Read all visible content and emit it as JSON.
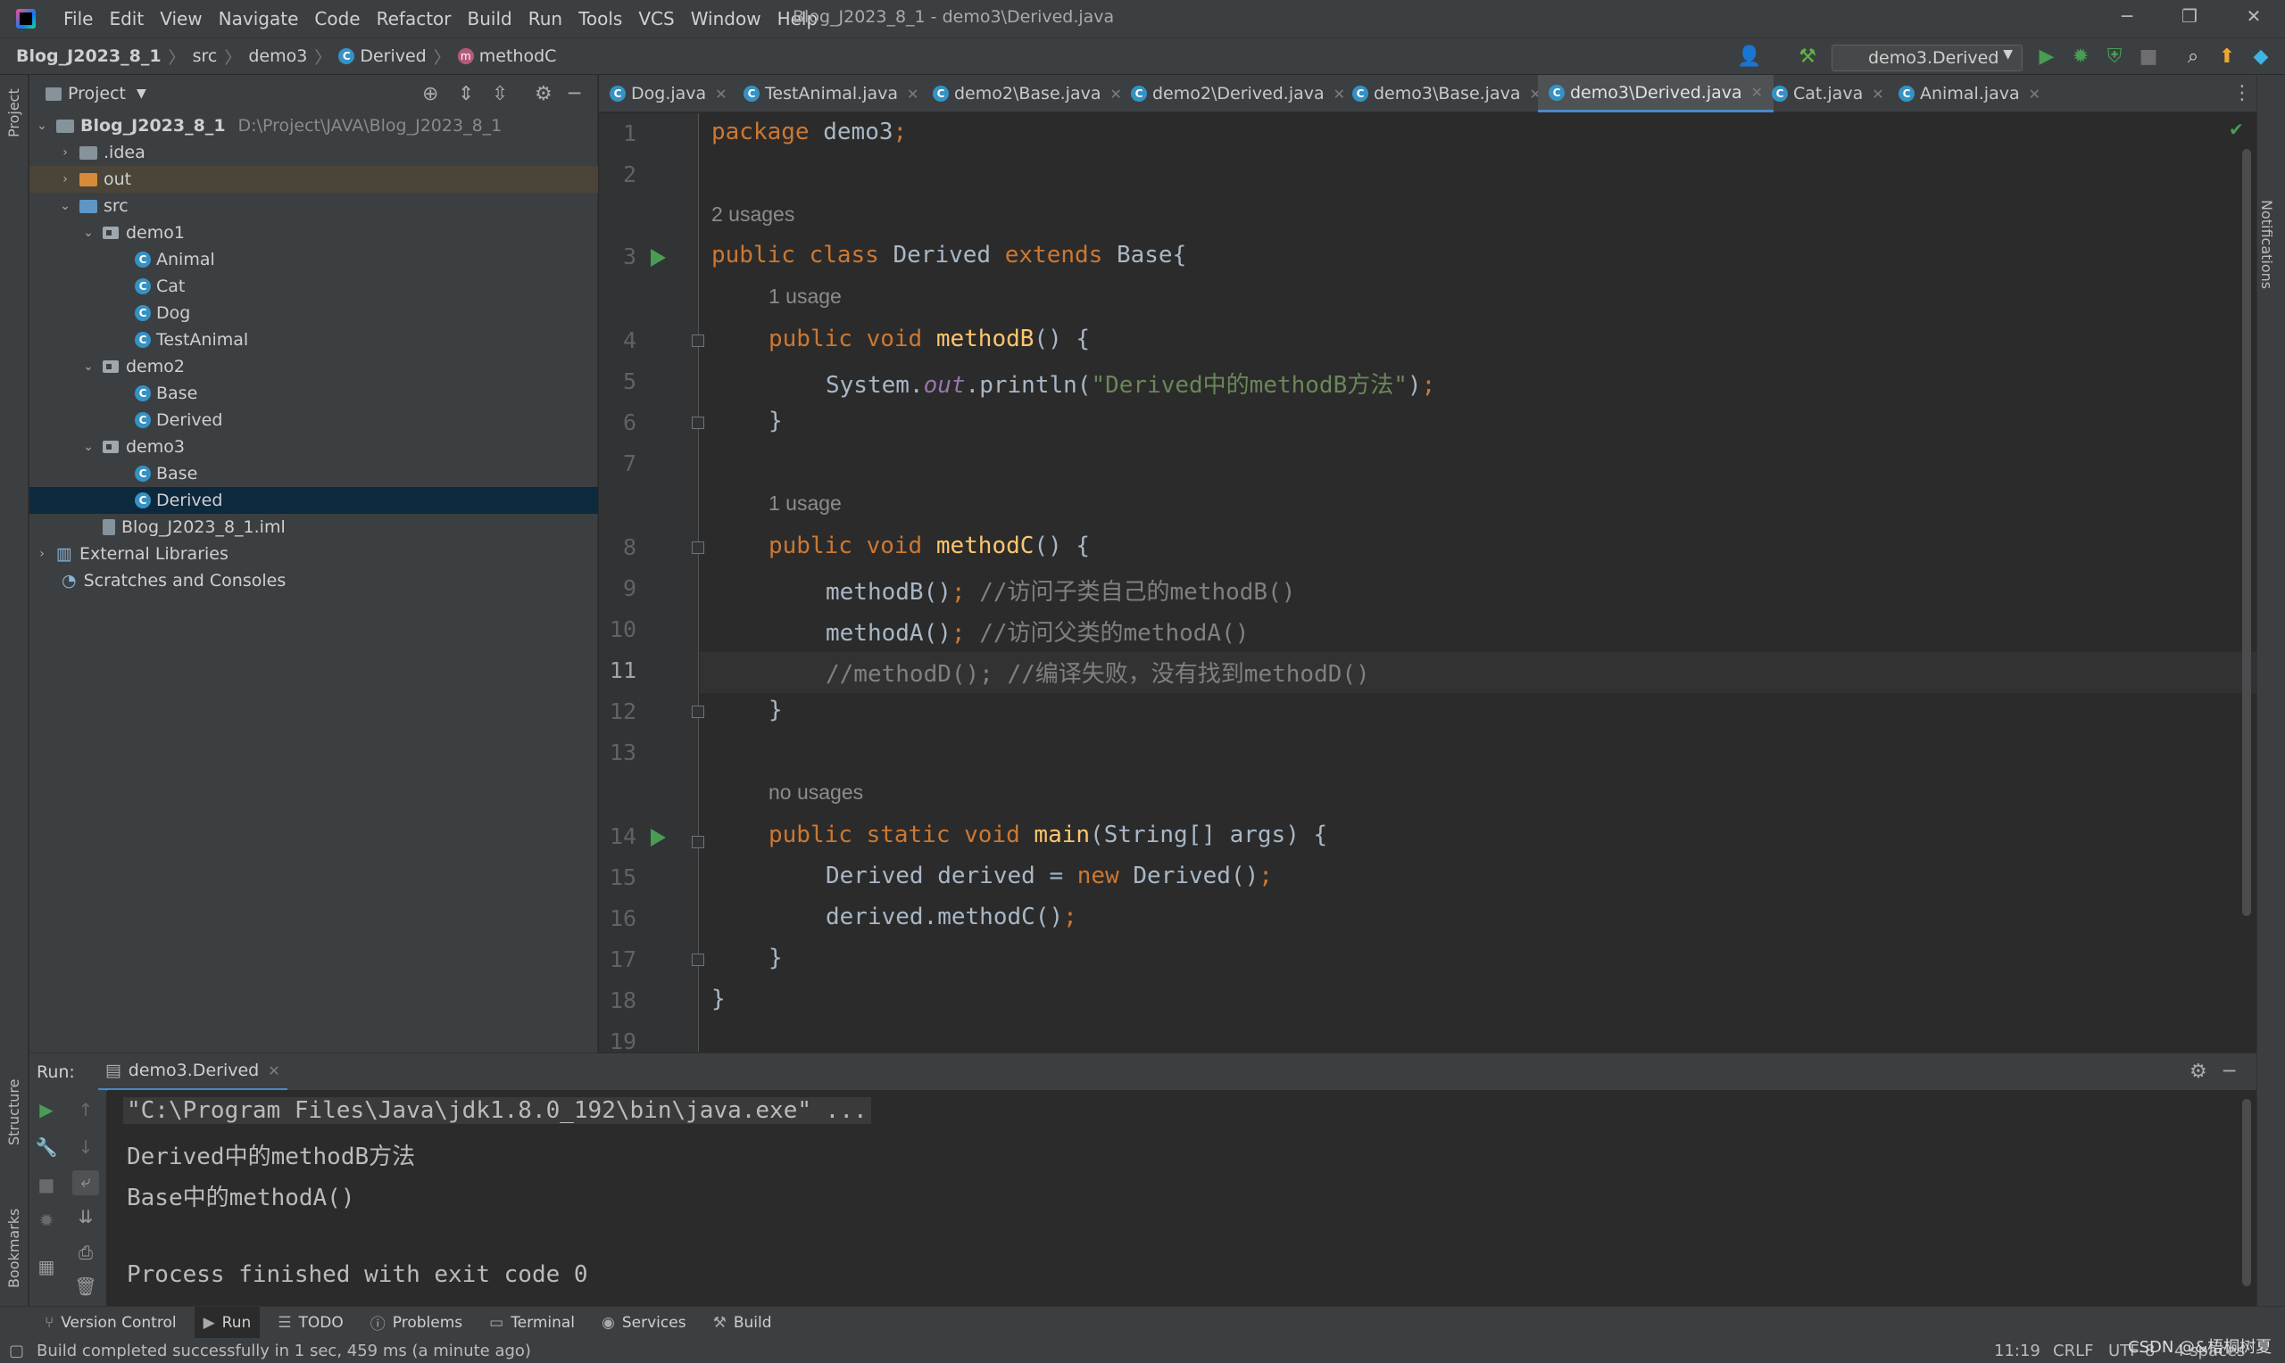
{
  "window": {
    "title": "Blog_J2023_8_1 - demo3\\Derived.java",
    "menu": [
      "File",
      "Edit",
      "View",
      "Navigate",
      "Code",
      "Refactor",
      "Build",
      "Run",
      "Tools",
      "VCS",
      "Window",
      "Help"
    ]
  },
  "navbar": {
    "breadcrumb": [
      "Blog_J2023_8_1",
      "src",
      "demo3",
      "Derived",
      "methodC"
    ],
    "run_config": "demo3.Derived"
  },
  "project": {
    "title": "Project",
    "tree": [
      {
        "label": "Blog_J2023_8_1",
        "path": "D:\\Project\\JAVA\\Blog_J2023_8_1"
      },
      {
        "label": ".idea"
      },
      {
        "label": "out"
      },
      {
        "label": "src"
      },
      {
        "label": "demo1"
      },
      {
        "label": "Animal"
      },
      {
        "label": "Cat"
      },
      {
        "label": "Dog"
      },
      {
        "label": "TestAnimal"
      },
      {
        "label": "demo2"
      },
      {
        "label": "Base"
      },
      {
        "label": "Derived"
      },
      {
        "label": "demo3"
      },
      {
        "label": "Base"
      },
      {
        "label": "Derived"
      },
      {
        "label": "Blog_J2023_8_1.iml"
      },
      {
        "label": "External Libraries"
      },
      {
        "label": "Scratches and Consoles"
      }
    ]
  },
  "tabs": [
    "Dog.java",
    "TestAnimal.java",
    "demo2\\Base.java",
    "demo2\\Derived.java",
    "demo3\\Base.java",
    "demo3\\Derived.java",
    "Cat.java",
    "Animal.java"
  ],
  "active_tab": "demo3\\Derived.java",
  "editor": {
    "line_numbers": [
      "1",
      "2",
      "3",
      "4",
      "5",
      "6",
      "7",
      "8",
      "9",
      "10",
      "11",
      "12",
      "13",
      "14",
      "15",
      "16",
      "17",
      "18",
      "19"
    ],
    "hints": [
      "2 usages",
      "1 usage",
      "1 usage",
      "no usages"
    ],
    "code": {
      "l1": {
        "kw": "package",
        "rest": " demo3",
        "semi": ";"
      },
      "l3": {
        "kw1": "public class",
        "name": " Derived ",
        "kw2": "extends",
        "rest": " Base{"
      },
      "l4": {
        "kw": "public void",
        "fn": "methodB",
        "rest": "() {"
      },
      "l5": {
        "a": "System.",
        "field": "out",
        "b": ".println(",
        "str": "\"Derived中的methodB方法\"",
        "c": ")",
        "semi": ";"
      },
      "l6": "}",
      "l8": {
        "kw": "public void",
        "fn": "methodC",
        "rest": "() {"
      },
      "l9": {
        "code": "methodB()",
        "semi": ";",
        "comment": " //访问子类自己的methodB()"
      },
      "l10": {
        "code": "methodA()",
        "semi": ";",
        "comment": " //访问父类的methodA()"
      },
      "l11": {
        "comment": "//methodD(); //编译失败，没有找到methodD()"
      },
      "l12": "}",
      "l14": {
        "kw": "public static void",
        "fn": "main",
        "rest": "(String[] args) {"
      },
      "l15": {
        "a": "Derived derived = ",
        "kw": "new",
        "b": " Derived()",
        "semi": ";"
      },
      "l16": {
        "a": "derived.methodC()",
        "semi": ";"
      },
      "l17": "}",
      "l18": "}"
    }
  },
  "run": {
    "label": "Run:",
    "tab": "demo3.Derived",
    "output": [
      "\"C:\\Program Files\\Java\\jdk1.8.0_192\\bin\\java.exe\" ...",
      "Derived中的methodB方法",
      "Base中的methodA()",
      "",
      "Process finished with exit code 0"
    ]
  },
  "bottom_tabs": [
    "Version Control",
    "Run",
    "TODO",
    "Problems",
    "Terminal",
    "Services",
    "Build"
  ],
  "side_labels": {
    "project": "Project",
    "structure": "Structure",
    "bookmarks": "Bookmarks",
    "notifications": "Notifications"
  },
  "status": {
    "message": "Build completed successfully in 1 sec, 459 ms (a minute ago)",
    "position": "11:19",
    "line_sep": "CRLF",
    "encoding": "UTF-8",
    "indent": "4 spaces",
    "watermark": "CSDN @&梧桐树夏"
  },
  "colors": {
    "keyword": "#cc7832",
    "function": "#ffc66d",
    "string": "#6a8759",
    "comment": "#808080",
    "field": "#9876aa",
    "selection": "#0d293e"
  }
}
